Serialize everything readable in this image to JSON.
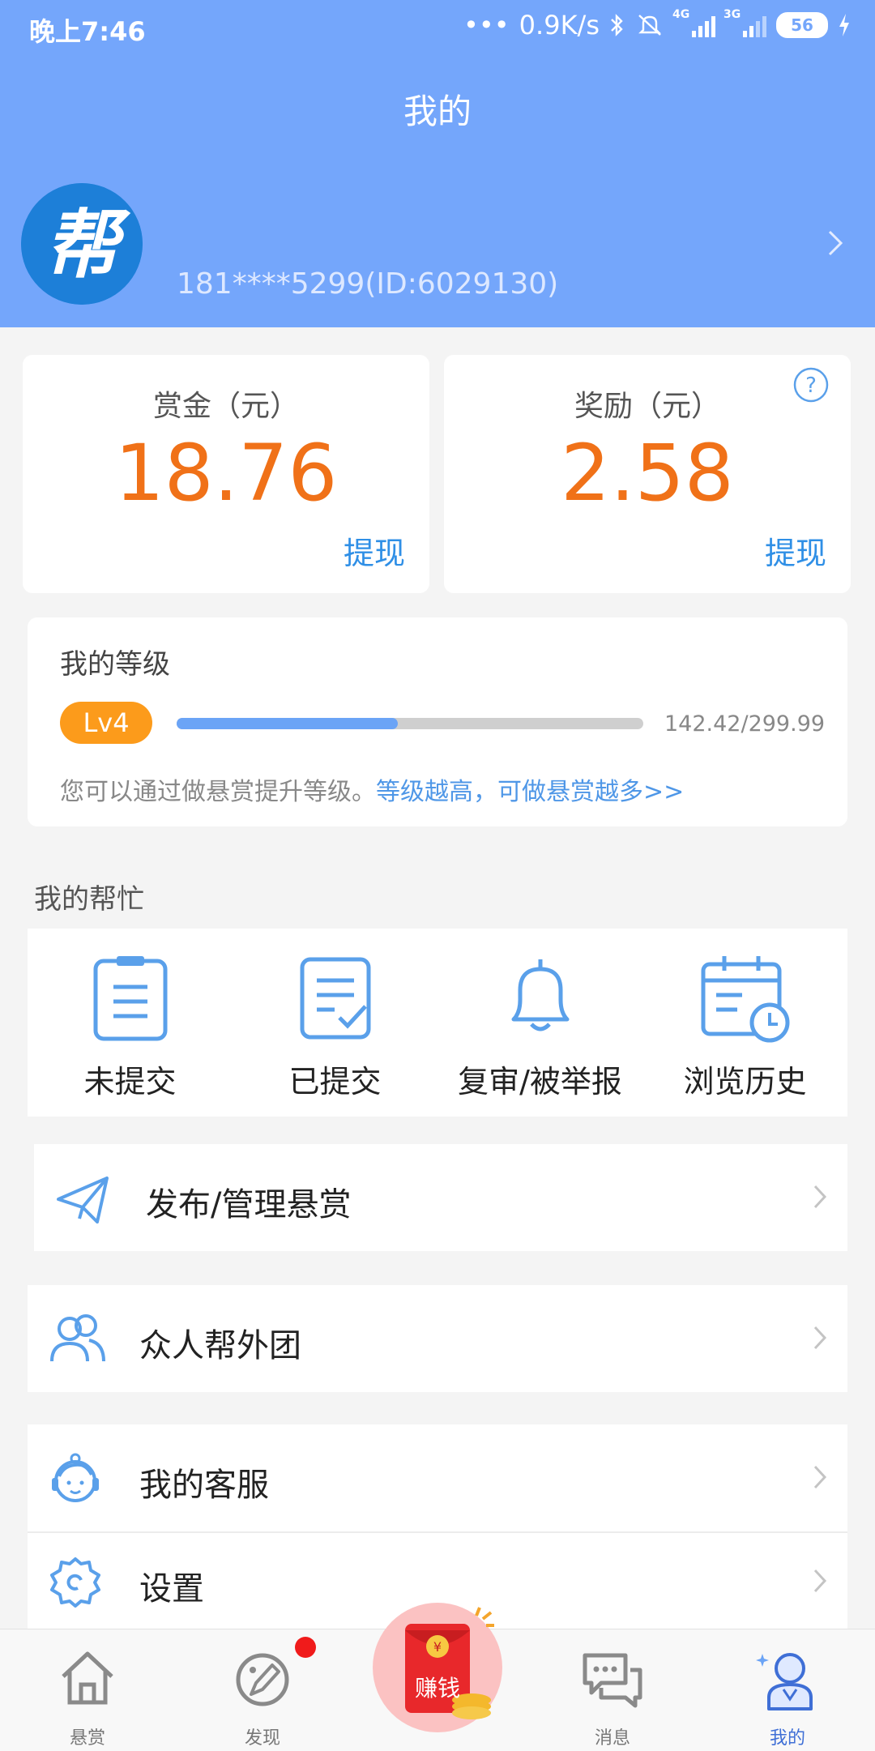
{
  "status_bar": {
    "time": "晚上7:46",
    "speed": "0.9K/s",
    "network_1": "4G",
    "network_2": "3G",
    "battery": "56"
  },
  "header": {
    "title": "我的"
  },
  "profile": {
    "avatar_char": "帮",
    "user_id": "181****5299(ID:6029130)"
  },
  "bounty": {
    "label": "赏金（元）",
    "amount": "18.76",
    "withdraw": "提现"
  },
  "reward": {
    "label": "奖励（元）",
    "amount": "2.58",
    "withdraw": "提现"
  },
  "level": {
    "title": "我的等级",
    "badge": "Lv4",
    "progress_text": "142.42/299.99",
    "progress_fraction": 0.4747,
    "tip": "您可以通过做悬赏提升等级。",
    "tip_link": "等级越高，可做悬赏越多>>"
  },
  "help": {
    "title": "我的帮忙",
    "items": [
      {
        "label": "未提交",
        "icon": "clipboard-icon"
      },
      {
        "label": "已提交",
        "icon": "document-check-icon"
      },
      {
        "label": "复审/被举报",
        "icon": "bell-icon"
      },
      {
        "label": "浏览历史",
        "icon": "calendar-clock-icon"
      }
    ]
  },
  "menu": {
    "publish": "发布/管理悬赏",
    "team": "众人帮外团",
    "service": "我的客服",
    "settings": "设置"
  },
  "tabs": [
    {
      "label": "悬赏",
      "icon": "home-icon"
    },
    {
      "label": "发现",
      "icon": "discover-icon"
    },
    {
      "label": "赚钱",
      "icon": "red-envelope-icon"
    },
    {
      "label": "消息",
      "icon": "chat-icon"
    },
    {
      "label": "我的",
      "icon": "profile-icon"
    }
  ],
  "colors": {
    "header_blue": "#74a6fb",
    "amount_orange": "#f07118",
    "link_blue": "#2f8fe6",
    "badge_orange": "#fc9b1b",
    "active_tab": "#3f6fd6"
  }
}
